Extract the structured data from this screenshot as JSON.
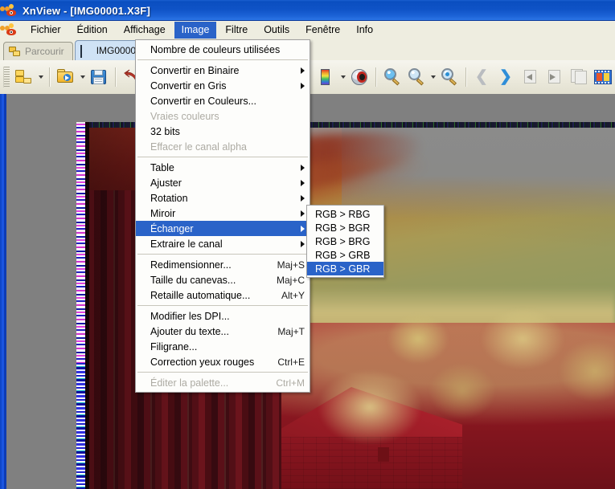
{
  "window": {
    "title": "XnView - [IMG00001.X3F]",
    "app_icon": "xnview-logo-icon"
  },
  "menubar": {
    "icon": "xnview-small-icon",
    "items": [
      {
        "label": "Fichier",
        "active": false
      },
      {
        "label": "Édition",
        "active": false
      },
      {
        "label": "Affichage",
        "active": false
      },
      {
        "label": "Image",
        "active": true
      },
      {
        "label": "Filtre",
        "active": false
      },
      {
        "label": "Outils",
        "active": false
      },
      {
        "label": "Fenêtre",
        "active": false
      },
      {
        "label": "Info",
        "active": false
      }
    ]
  },
  "tabs": [
    {
      "label": "Parcourir",
      "icon": "folders-icon",
      "active": false
    },
    {
      "label": "IMG00001.",
      "icon": "thumbnail-icon",
      "active": true
    }
  ],
  "toolbar": {
    "buttons": [
      {
        "name": "browse-button",
        "icon": "folders-icon"
      },
      {
        "name": "browse-dropdown",
        "icon": "chevron-down-icon"
      },
      {
        "name": "open-button",
        "icon": "open-folder-icon"
      },
      {
        "name": "open-dropdown",
        "icon": "chevron-down-icon"
      },
      {
        "name": "save-button",
        "icon": "floppy-disk-icon"
      },
      {
        "name": "undo-button",
        "icon": "undo-arrow-icon"
      },
      {
        "name": "palette-button",
        "icon": "color-strip-icon"
      },
      {
        "name": "palette-dropdown",
        "icon": "chevron-down-icon"
      },
      {
        "name": "red-eye-button",
        "icon": "eye-icon"
      },
      {
        "name": "zoom-in-button",
        "icon": "magnifier-plus-icon"
      },
      {
        "name": "zoom-out-button",
        "icon": "magnifier-icon"
      },
      {
        "name": "zoom-dropdown",
        "icon": "chevron-down-icon"
      },
      {
        "name": "zoom-fit-button",
        "icon": "magnifier-dot-icon"
      },
      {
        "name": "previous-button",
        "icon": "chevron-left-icon"
      },
      {
        "name": "next-button",
        "icon": "chevron-right-icon"
      },
      {
        "name": "first-page-button",
        "icon": "page-back-icon"
      },
      {
        "name": "last-page-button",
        "icon": "page-forward-icon"
      },
      {
        "name": "compare-button",
        "icon": "pages-icon"
      },
      {
        "name": "slideshow-button",
        "icon": "filmstrip-icon"
      },
      {
        "name": "slideshow-dropdown",
        "icon": "chevron-down-icon"
      }
    ]
  },
  "image_menu": {
    "groups": [
      {
        "items": [
          {
            "label": "Nombre de couleurs utilisées",
            "accel": "",
            "submenu": false,
            "disabled": false,
            "selected": false
          }
        ]
      },
      {
        "items": [
          {
            "label": "Convertir en Binaire",
            "accel": "",
            "submenu": true,
            "disabled": false,
            "selected": false
          },
          {
            "label": "Convertir en Gris",
            "accel": "",
            "submenu": true,
            "disabled": false,
            "selected": false
          },
          {
            "label": "Convertir en Couleurs...",
            "accel": "",
            "submenu": false,
            "disabled": false,
            "selected": false
          },
          {
            "label": "Vraies couleurs",
            "accel": "",
            "submenu": false,
            "disabled": true,
            "selected": false
          },
          {
            "label": "32 bits",
            "accel": "",
            "submenu": false,
            "disabled": false,
            "selected": false
          },
          {
            "label": "Effacer le canal alpha",
            "accel": "",
            "submenu": false,
            "disabled": true,
            "selected": false
          }
        ]
      },
      {
        "items": [
          {
            "label": "Table",
            "accel": "",
            "submenu": true,
            "disabled": false,
            "selected": false
          },
          {
            "label": "Ajuster",
            "accel": "",
            "submenu": true,
            "disabled": false,
            "selected": false
          },
          {
            "label": "Rotation",
            "accel": "",
            "submenu": true,
            "disabled": false,
            "selected": false
          },
          {
            "label": "Miroir",
            "accel": "",
            "submenu": true,
            "disabled": false,
            "selected": false
          },
          {
            "label": "Échanger",
            "accel": "",
            "submenu": true,
            "disabled": false,
            "selected": true
          },
          {
            "label": "Extraire le canal",
            "accel": "",
            "submenu": true,
            "disabled": false,
            "selected": false
          }
        ]
      },
      {
        "items": [
          {
            "label": "Redimensionner...",
            "accel": "Maj+S",
            "submenu": false,
            "disabled": false,
            "selected": false
          },
          {
            "label": "Taille du canevas...",
            "accel": "Maj+C",
            "submenu": false,
            "disabled": false,
            "selected": false
          },
          {
            "label": "Retaille automatique...",
            "accel": "Alt+Y",
            "submenu": false,
            "disabled": false,
            "selected": false
          }
        ]
      },
      {
        "items": [
          {
            "label": "Modifier les DPI...",
            "accel": "",
            "submenu": false,
            "disabled": false,
            "selected": false
          },
          {
            "label": "Ajouter du texte...",
            "accel": "Maj+T",
            "submenu": false,
            "disabled": false,
            "selected": false
          },
          {
            "label": "Filigrane...",
            "accel": "",
            "submenu": false,
            "disabled": false,
            "selected": false
          },
          {
            "label": "Correction yeux rouges",
            "accel": "Ctrl+E",
            "submenu": false,
            "disabled": false,
            "selected": false
          }
        ]
      },
      {
        "items": [
          {
            "label": "Éditer la palette...",
            "accel": "Ctrl+M",
            "submenu": false,
            "disabled": true,
            "selected": false
          }
        ]
      }
    ]
  },
  "swap_submenu": {
    "items": [
      {
        "label": "RGB > RBG",
        "selected": false
      },
      {
        "label": "RGB > BGR",
        "selected": false
      },
      {
        "label": "RGB > BRG",
        "selected": false
      },
      {
        "label": "RGB > GRB",
        "selected": false
      },
      {
        "label": "RGB > GBR",
        "selected": true
      }
    ]
  },
  "colors": {
    "title_bar_blue": "#0a4ec0",
    "menu_highlight": "#2a63c8",
    "menu_background": "#fdfdfb",
    "toolbar_background": "#eceadd",
    "canvas_background": "#808080",
    "disabled_text": "#adaba3"
  }
}
